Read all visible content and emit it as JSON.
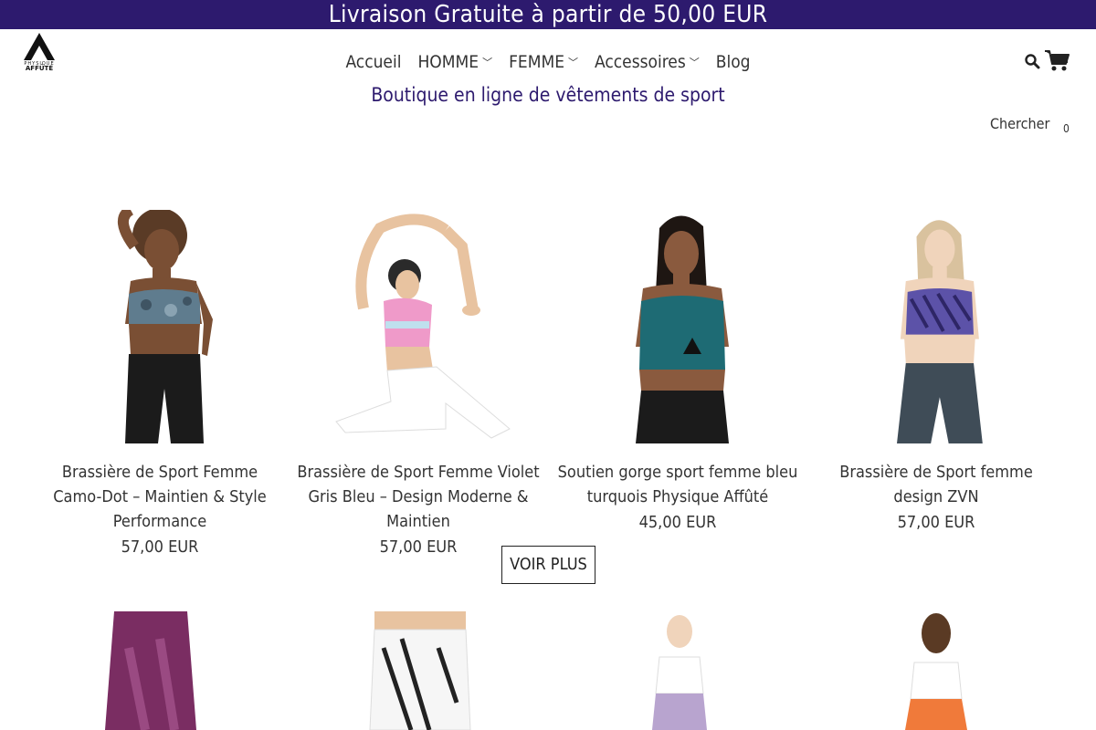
{
  "announcement": "Livraison Gratuite à partir de 50,00 EUR",
  "nav": {
    "items": [
      {
        "label": "Accueil",
        "dropdown": false
      },
      {
        "label": "HOMME",
        "dropdown": true
      },
      {
        "label": "FEMME",
        "dropdown": true
      },
      {
        "label": "Accessoires",
        "dropdown": true
      },
      {
        "label": "Blog",
        "dropdown": false
      }
    ],
    "chevron": "⌄"
  },
  "tagline": "Boutique en ligne de vêtements de sport",
  "header": {
    "search_label": "Chercher",
    "cart_count": "0"
  },
  "icons": {
    "logo": "physique-affute-logo",
    "search": "search-icon",
    "cart": "cart-icon"
  },
  "colors": {
    "brand_purple": "#2d1a6e"
  },
  "products": [
    {
      "title": "Brassière de Sport Femme Camo-Dot – Maintien & Style Performance",
      "price": "57,00 EUR"
    },
    {
      "title": "Brassière de Sport Femme Violet Gris Bleu – Design Moderne & Maintien",
      "price": "57,00 EUR"
    },
    {
      "title": "Soutien gorge sport femme bleu turquois Physique Affûté",
      "price": "45,00 EUR"
    },
    {
      "title": "Brassière de Sport femme design ZVN",
      "price": "57,00 EUR"
    }
  ],
  "voir_plus": "VOIR PLUS"
}
